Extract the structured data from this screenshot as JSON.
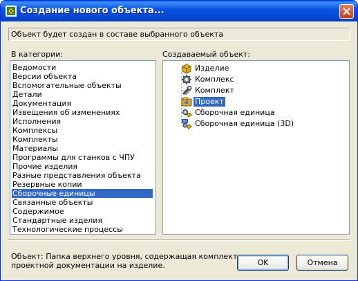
{
  "window": {
    "title": "Создание нового объекта..."
  },
  "info_text": "Объект будет создан в составе выбранного объекта",
  "categories": {
    "label": "В категории:",
    "items": [
      "Ведомости",
      "Версии объекта",
      "Вспомогательные объекты",
      "Детали",
      "Документация",
      "Извещения об изменениях",
      "Исполнения",
      "Комплексы",
      "Комплекты",
      "Материалы",
      "Программы для станков с ЧПУ",
      "Прочие изделия",
      "Разные представления объекта",
      "Резервные копии",
      "Сборочные единицы",
      "Связанные объекты",
      "Содержимое",
      "Стандартные изделия",
      "Технологические процессы"
    ],
    "selected_index": 14
  },
  "objects": {
    "label": "Создаваемый объект:",
    "items": [
      {
        "label": "Изделие",
        "icon": "product-box-icon"
      },
      {
        "label": "Комплекс",
        "icon": "complex-gear-icon"
      },
      {
        "label": "Комплект",
        "icon": "kit-tools-icon"
      },
      {
        "label": "Проект",
        "icon": "project-icon"
      },
      {
        "label": "Сборочная единица",
        "icon": "assembly-unit-icon"
      },
      {
        "label": "Сборочная единица (3D)",
        "icon": "assembly-3d-icon"
      }
    ],
    "selected_index": 3
  },
  "description": "Объект: Папка верхнего уровня, содержащая комплект проектной документации на изделие.",
  "buttons": {
    "ok": "OK",
    "cancel": "Отмена"
  },
  "colors": {
    "selection": "#316ac5",
    "titlebar": "#0a55e0",
    "dialog_bg": "#ece9d8"
  }
}
